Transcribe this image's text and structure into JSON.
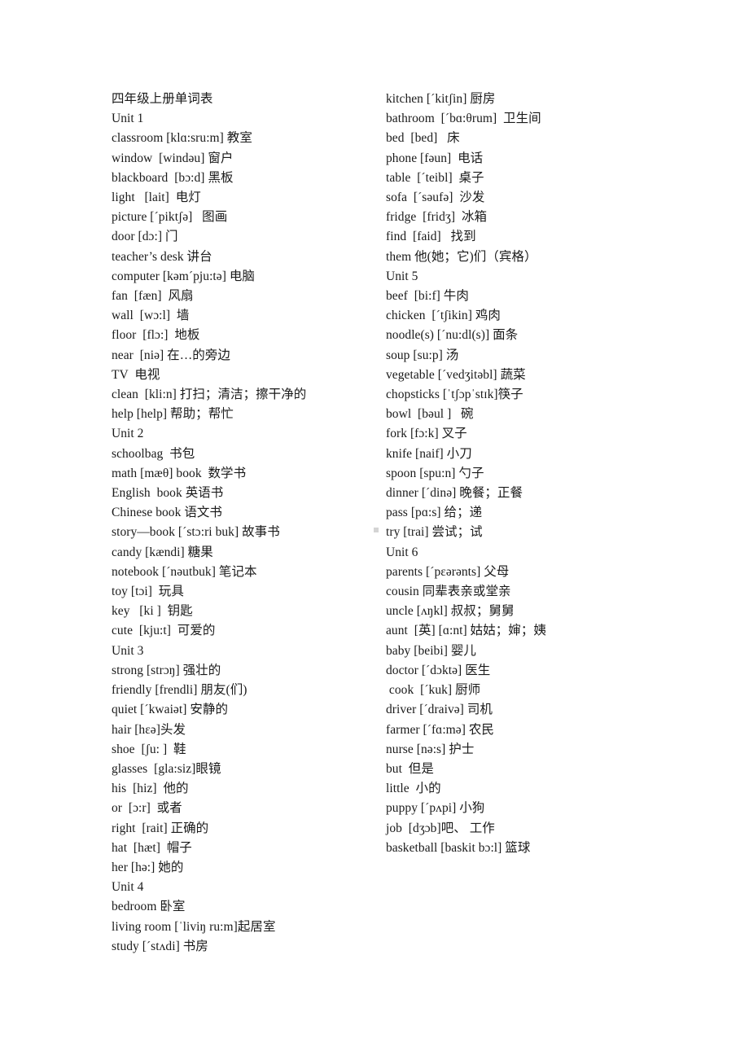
{
  "document": {
    "title": "四年级上册单词表",
    "left_column": [
      "四年级上册单词表",
      "Unit 1",
      "classroom [klɑ:sru:m] 教室",
      "window  [windəu] 窗户",
      "blackboard  [bɔ:d] 黑板",
      "light   [lait]  电灯",
      "picture [ˊpiktʃə]   图画",
      "door [dɔ:] 门",
      "teacher’s desk 讲台",
      "computer [kəmˊpju:tə] 电脑",
      "fan  [fæn]  风扇",
      "wall  [wɔ:l]  墙",
      "floor  [flɔ:]  地板",
      "near  [niə] 在…的旁边",
      "TV  电视",
      "clean  [kli:n] 打扫；清洁；擦干净的",
      "help [help] 帮助；帮忙",
      "Unit 2",
      "schoolbag  书包",
      "math [mæθ] book  数学书",
      "English  book 英语书",
      "Chinese book 语文书",
      "story—book [ˊstɔ:ri buk] 故事书",
      "candy [kændi] 糖果",
      "notebook [ˊnəutbuk] 笔记本",
      "toy [tɔi]  玩具",
      "key   [ki ]  钥匙",
      "cute  [kju:t]  可爱的",
      "Unit 3",
      "strong [strɔŋ] 强壮的",
      "friendly [frendli] 朋友(们)",
      "quiet [ˊkwaiət] 安静的",
      "hair [hɛə]头发",
      "shoe  [ʃu: ]  鞋",
      "glasses  [gla:siz]眼镜",
      "his  [hiz]  他的",
      "or  [ɔ:r]  或者",
      "right  [rait] 正确的",
      "hat  [hæt]  帽子",
      "her [hə:] 她的",
      "Unit 4",
      "bedroom 卧室",
      "living room [ˈliviŋ ru:m]起居室",
      "study [ˊstʌdi] 书房"
    ],
    "right_column": [
      "kitchen [ˊkitʃin] 厨房",
      "bathroom  [ˊbɑ:θrum]  卫生间",
      "bed  [bed]   床",
      "phone [fəun]  电话",
      "table  [ˊteibl]  桌子",
      "sofa  [ˊsəufə]  沙发",
      "fridge  [fridʒ]  冰箱",
      "find  [faid]   找到",
      "them 他(她；它)们（宾格）",
      "Unit 5",
      "beef  [bi:f] 牛肉",
      "chicken  [ˊtʃikin] 鸡肉",
      "noodle(s) [ˊnu:dl(s)] 面条",
      "soup [su:p] 汤",
      "vegetable [ˊvedʒitəbl] 蔬菜",
      "chopsticks [ˈtʃɔpˈstɪk]筷子",
      "bowl  [bəul ]   碗",
      "fork [fɔ:k] 叉子",
      "knife [naif] 小刀",
      "spoon [spu:n] 勺子",
      "dinner [ˊdinə] 晚餐；正餐",
      "pass [pɑ:s] 给；递",
      "try [trai] 尝试；试",
      "Unit 6",
      "parents [ˊpɛərənts] 父母",
      "cousin 同辈表亲或堂亲",
      "uncle [ʌŋkl] 叔叔；舅舅",
      "aunt  [英] [ɑ:nt] 姑姑；婶；姨",
      "baby [beibi] 婴儿",
      "doctor [ˊdɔktə] 医生",
      " cook  [ˊkuk] 厨师",
      "driver [ˊdraivə] 司机",
      "farmer [ˊfɑ:mə] 农民",
      "nurse [nə:s] 护士",
      "but  但是",
      "little  小的",
      "puppy [ˊpʌpi] 小狗",
      "job  [dʒɔb]吧、 工作",
      "basketball [baskit bɔ:l] 篮球"
    ]
  }
}
